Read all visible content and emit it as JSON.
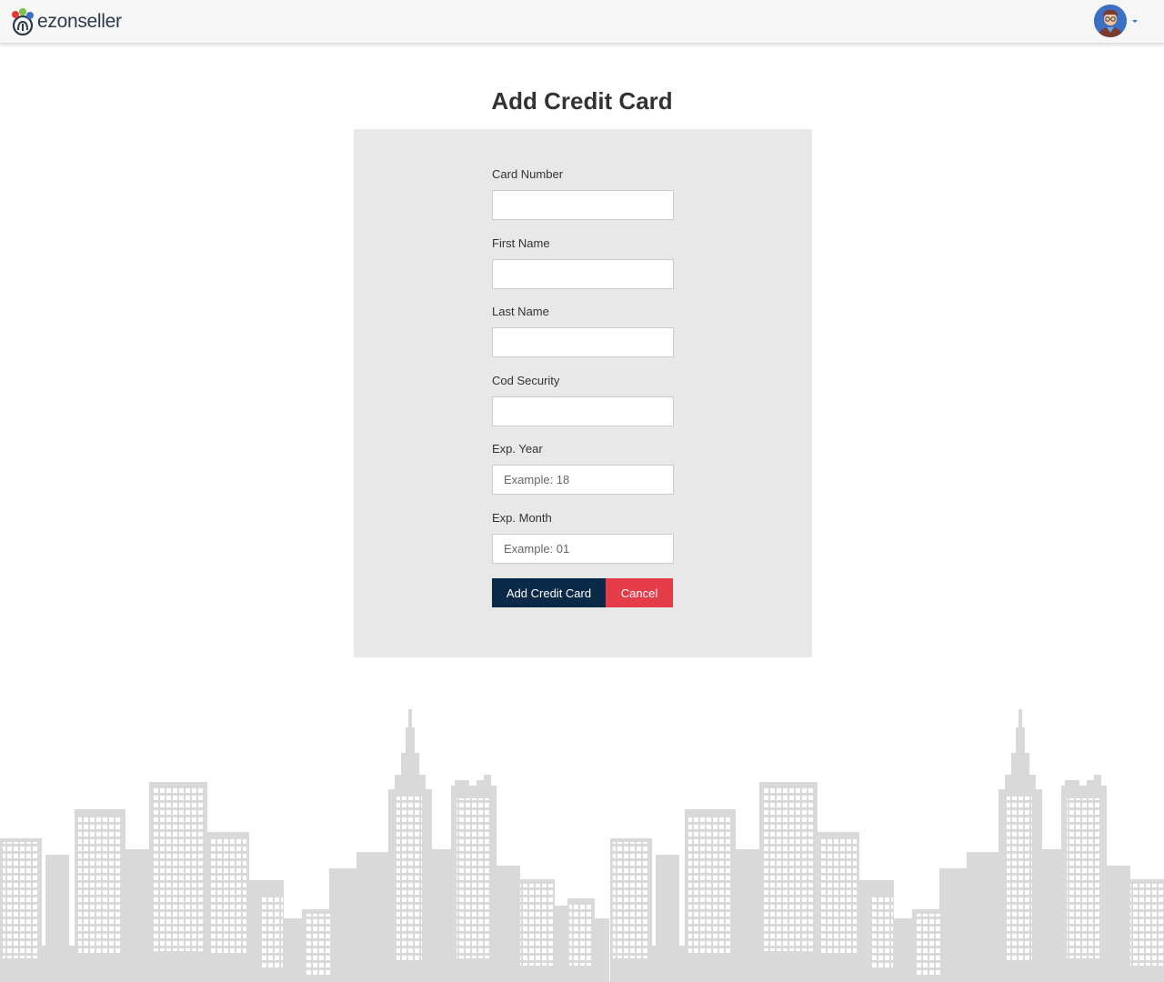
{
  "header": {
    "logo_text": "ezonseller",
    "user_menu": "user-avatar"
  },
  "page": {
    "title": "Add Credit Card"
  },
  "form": {
    "fields": [
      {
        "label": "Card Number",
        "value": "",
        "placeholder": ""
      },
      {
        "label": "First Name",
        "value": "",
        "placeholder": ""
      },
      {
        "label": "Last Name",
        "value": "",
        "placeholder": ""
      },
      {
        "label": "Cod Security",
        "value": "",
        "placeholder": ""
      },
      {
        "label": "Exp. Year",
        "value": "",
        "placeholder": "Example: 18"
      },
      {
        "label": "Exp. Month",
        "value": "",
        "placeholder": "Example: 01"
      }
    ],
    "submit_label": "Add Credit Card",
    "cancel_label": "Cancel"
  },
  "colors": {
    "primary": "#0b2a47",
    "danger": "#e63c4a",
    "panel": "#e8e8e8",
    "skyline": "#d9d9d9"
  }
}
